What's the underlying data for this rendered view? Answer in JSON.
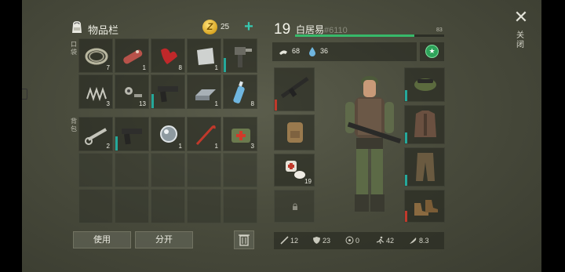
{
  "inventory": {
    "title": "物品栏",
    "coins": "25",
    "add_label": "+",
    "pockets_label": "口袋",
    "backpack_label": "背包",
    "use_label": "使用",
    "split_label": "分开",
    "pocket_items": [
      {
        "name": "rope",
        "count": "7"
      },
      {
        "name": "sausage",
        "count": "1"
      },
      {
        "name": "red-cloth",
        "count": "8"
      },
      {
        "name": "metal-sheet",
        "count": "1"
      },
      {
        "name": "hand-drill",
        "count": ""
      },
      {
        "name": "spring",
        "count": "3"
      },
      {
        "name": "nuts-bolts",
        "count": "13"
      },
      {
        "name": "pistol",
        "count": ""
      },
      {
        "name": "steel-ingot",
        "count": "1"
      },
      {
        "name": "water-bottle",
        "count": "8"
      }
    ],
    "backpack_items": [
      {
        "name": "wrench",
        "count": "2"
      },
      {
        "name": "pistol",
        "count": ""
      },
      {
        "name": "glass-lens",
        "count": "1"
      },
      {
        "name": "crowbar",
        "count": "1"
      },
      {
        "name": "first-aid-kit",
        "count": "3"
      }
    ]
  },
  "character": {
    "level": "19",
    "name": "白居易",
    "id": "#6110",
    "xp_value": "83",
    "xp_fraction": 0.8,
    "food": "68",
    "water": "36",
    "backpack_count": "19",
    "stats": {
      "attack": "12",
      "defense": "23",
      "radiation": "0",
      "speed": "42",
      "weight": "8.3"
    }
  },
  "close_label": "关闭",
  "colors": {
    "accent": "#37c8b0",
    "xp": "#37b96a",
    "durability": "#25a89a",
    "warning": "#c0392b"
  }
}
